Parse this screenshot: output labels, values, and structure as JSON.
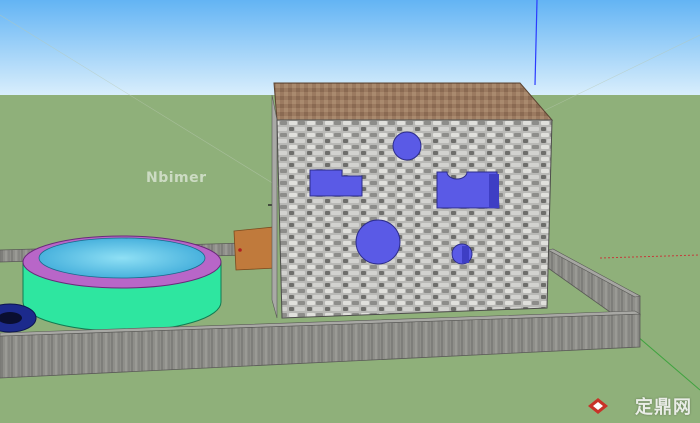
{
  "viewport": {
    "sky_color_top": "#63b4f4",
    "sky_color_bottom": "#d9eefc",
    "ground_color": "#8fb07a",
    "axis_color_blue": "#2a3bff",
    "axis_color_green": "#3fa33f",
    "axis_color_red": "#c53a3a"
  },
  "model": {
    "building": {
      "wall_material": "stone",
      "roof_color": "#9b7a60",
      "openings_color": "#5a5ae6"
    },
    "pool": {
      "outer_color": "#2ee6a0",
      "rim_color": "#b866c8",
      "water_color": "#4cc0e8"
    },
    "tire_color": "#1c2a8c",
    "fence_color": "#8a8a86",
    "sign_color": "#c07a3c"
  },
  "watermarks": {
    "left_text": "Nbimer",
    "right_text": "定鼎网",
    "right_icon": "diamond-logo-icon"
  }
}
